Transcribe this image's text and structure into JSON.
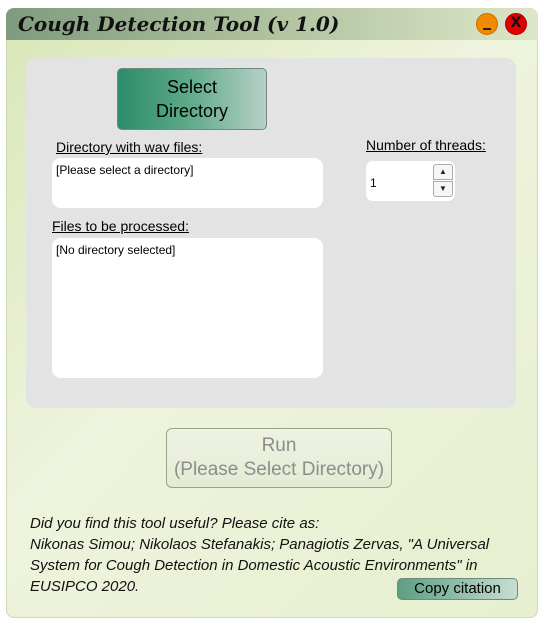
{
  "window": {
    "title": "Cough Detection Tool (v 1.0)",
    "minimize_label": "_",
    "close_label": "X"
  },
  "main": {
    "select_button_line1": "Select",
    "select_button_line2": "Directory",
    "dir_label": "Directory with wav files:",
    "dir_value": "[Please select a directory]",
    "threads_label": "Number of threads:",
    "threads_value": "1",
    "files_label": "Files to be processed:",
    "files_value": "[No directory selected]",
    "run_line1": "Run",
    "run_line2": "(Please Select Directory)"
  },
  "citation": {
    "line1": "Did you find this tool useful? Please cite as:",
    "line2": "Nikonas Simou; Nikolaos Stefanakis; Panagiotis Zervas, \"A Universal",
    "line3": "System for Cough Detection in Domestic Acoustic Environments\" in",
    "line4": "EUSIPCO 2020.",
    "copy_label": "Copy citation"
  }
}
